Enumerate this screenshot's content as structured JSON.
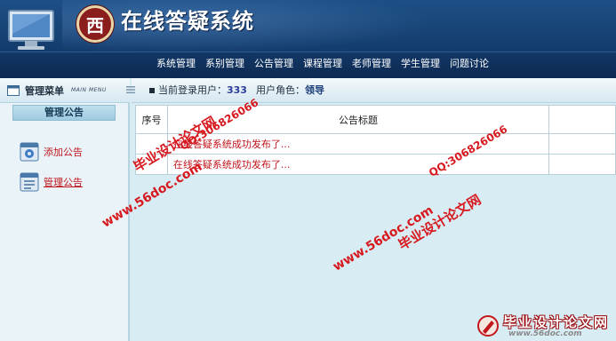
{
  "header": {
    "logo_text": "西",
    "title": "在线答疑系统"
  },
  "nav": {
    "items": [
      "系统管理",
      "系别管理",
      "公告管理",
      "课程管理",
      "老师管理",
      "学生管理",
      "问题讨论"
    ]
  },
  "sidebar": {
    "title": "管理菜单",
    "subtitle": "MAIN MENU",
    "section": "管理公告",
    "items": [
      {
        "label": "添加公告",
        "icon": "gear-window-icon"
      },
      {
        "label": "管理公告",
        "icon": "document-window-icon"
      }
    ]
  },
  "topbar": {
    "current_user_label": "当前登录用户：",
    "current_user_value": "333",
    "role_label": "用户角色：",
    "role_value": "领导"
  },
  "table": {
    "headers": [
      "序号",
      "公告标题",
      ""
    ],
    "rows": [
      {
        "no": "",
        "title": "在线答疑系统成功发布了..."
      },
      {
        "no": "",
        "title": "在线答疑系统成功发布了..."
      }
    ]
  },
  "watermarks": {
    "site_cn": "毕业设计论文网",
    "qq": "QQ:306826066",
    "url": "www.56doc.com",
    "corner_cn": "毕业设计论文网",
    "corner_url": "www.56doc.com"
  },
  "colors": {
    "header_blue": "#153f70",
    "link_red": "#c0141c",
    "watermark_red": "#d7191f",
    "panel_bg": "#d8ecf4"
  }
}
